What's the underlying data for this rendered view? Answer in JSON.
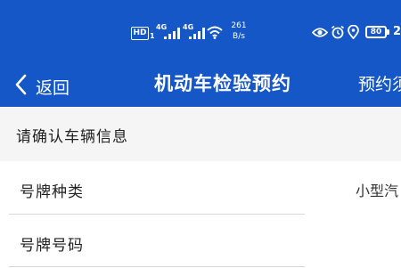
{
  "status_bar": {
    "hd_badge": "HD",
    "network_1": "4G",
    "network_2": "4G",
    "net_speed_value": "261",
    "net_speed_unit": "B/s",
    "battery_level": "80",
    "clock_partial": "2"
  },
  "nav": {
    "back_label": "返回",
    "title": "机动车检验预约",
    "right_link": "预约须"
  },
  "section": {
    "title": "请确认车辆信息"
  },
  "rows": [
    {
      "label": "号牌种类",
      "value": "小型汽"
    },
    {
      "label": "号牌号码",
      "value": ""
    }
  ],
  "colors": {
    "brand_blue": "#1657c7",
    "section_bg": "#f5f5f5"
  }
}
